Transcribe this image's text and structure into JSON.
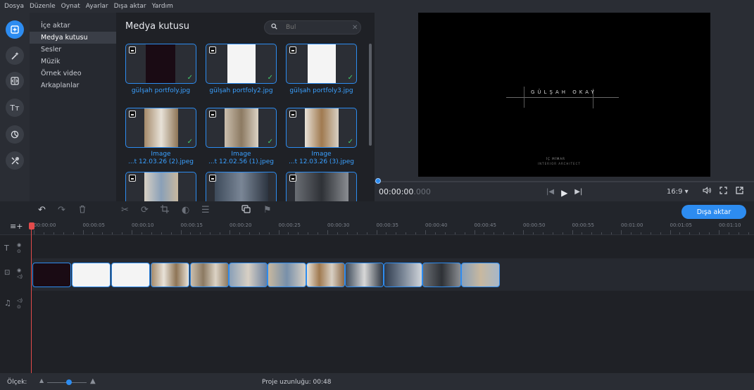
{
  "menubar": {
    "items": [
      "Dosya",
      "Düzenle",
      "Oynat",
      "Ayarlar",
      "Dışa aktar",
      "Yardım"
    ]
  },
  "rail": {
    "icons": [
      "add-media-icon",
      "magic-wand-icon",
      "transitions-icon",
      "titles-icon",
      "stickers-icon",
      "tools-icon"
    ],
    "titles_glyph": "Tт"
  },
  "categories": {
    "items": [
      {
        "label": "İçe aktar",
        "active": false
      },
      {
        "label": "Medya kutusu",
        "active": true
      },
      {
        "label": "Sesler",
        "active": false
      },
      {
        "label": "Müzik",
        "active": false
      },
      {
        "label": "Örnek video",
        "active": false
      },
      {
        "label": "Arkaplanlar",
        "active": false
      }
    ]
  },
  "media": {
    "title": "Medya kutusu",
    "search_placeholder": "Bul",
    "tiles": [
      {
        "label": "gülşah portfoly.jpg",
        "label2": ""
      },
      {
        "label": "gülşah portfoly2.jpg",
        "label2": ""
      },
      {
        "label": "gülşah portfoly3.jpg",
        "label2": ""
      },
      {
        "label": "Image",
        "label2": "...t 12.03.26 (2).jpeg"
      },
      {
        "label": "Image",
        "label2": "...t 12.02.56 (1).jpeg"
      },
      {
        "label": "Image",
        "label2": "...t 12.03.26 (3).jpeg"
      },
      {
        "label": "",
        "label2": ""
      },
      {
        "label": "",
        "label2": ""
      },
      {
        "label": "",
        "label2": ""
      }
    ]
  },
  "preview": {
    "title_text": "GÜLŞAH OKAY",
    "sub1": "İÇ MİMAR",
    "sub2": "INTERIOR ARCHITECT",
    "timecode_main": "00:00:00",
    "timecode_ms": ".000",
    "aspect_ratio": "16:9 ▾",
    "progress": 0.0
  },
  "toolbar": {
    "export_label": "Dışa aktar"
  },
  "ruler": {
    "labels": [
      "00:00:00",
      "00:00:05",
      "00:00:10",
      "00:00:15",
      "00:00:20",
      "00:00:25",
      "00:00:30",
      "00:00:35",
      "00:00:40",
      "00:00:45",
      "00:00:50",
      "00:00:55",
      "00:01:00",
      "00:01:05",
      "00:01:10"
    ]
  },
  "status": {
    "scale_label": "Ölçek:",
    "project_length": "Proje uzunluğu: 00:48",
    "scale_level": 0.55
  },
  "colors": {
    "accent": "#2d8cf0",
    "check": "#43c96b",
    "playhead": "#e34b4b"
  }
}
